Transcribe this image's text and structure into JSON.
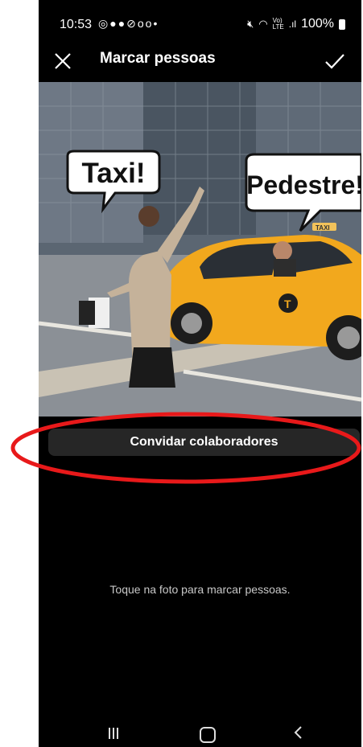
{
  "status_bar": {
    "time": "10:53",
    "notification_icons": [
      "whatsapp-icon",
      "messenger-icon",
      "facebook-icon",
      "check-circle-icon",
      "voicemail-icon",
      "dot-icon"
    ],
    "right_icons": [
      "mute-icon",
      "wifi-icon",
      "volte-icon",
      "signal-icon"
    ],
    "battery": "100%"
  },
  "app_bar": {
    "title": "Marcar pessoas"
  },
  "photo": {
    "bubble_left": "Taxi!",
    "bubble_right": "Pedestre!",
    "taxi_sign": "TAXI"
  },
  "invite_button": {
    "label": "Convidar colaboradores"
  },
  "hint": "Toque na foto para marcar pessoas.",
  "annotation": {
    "color": "#e8191a"
  }
}
